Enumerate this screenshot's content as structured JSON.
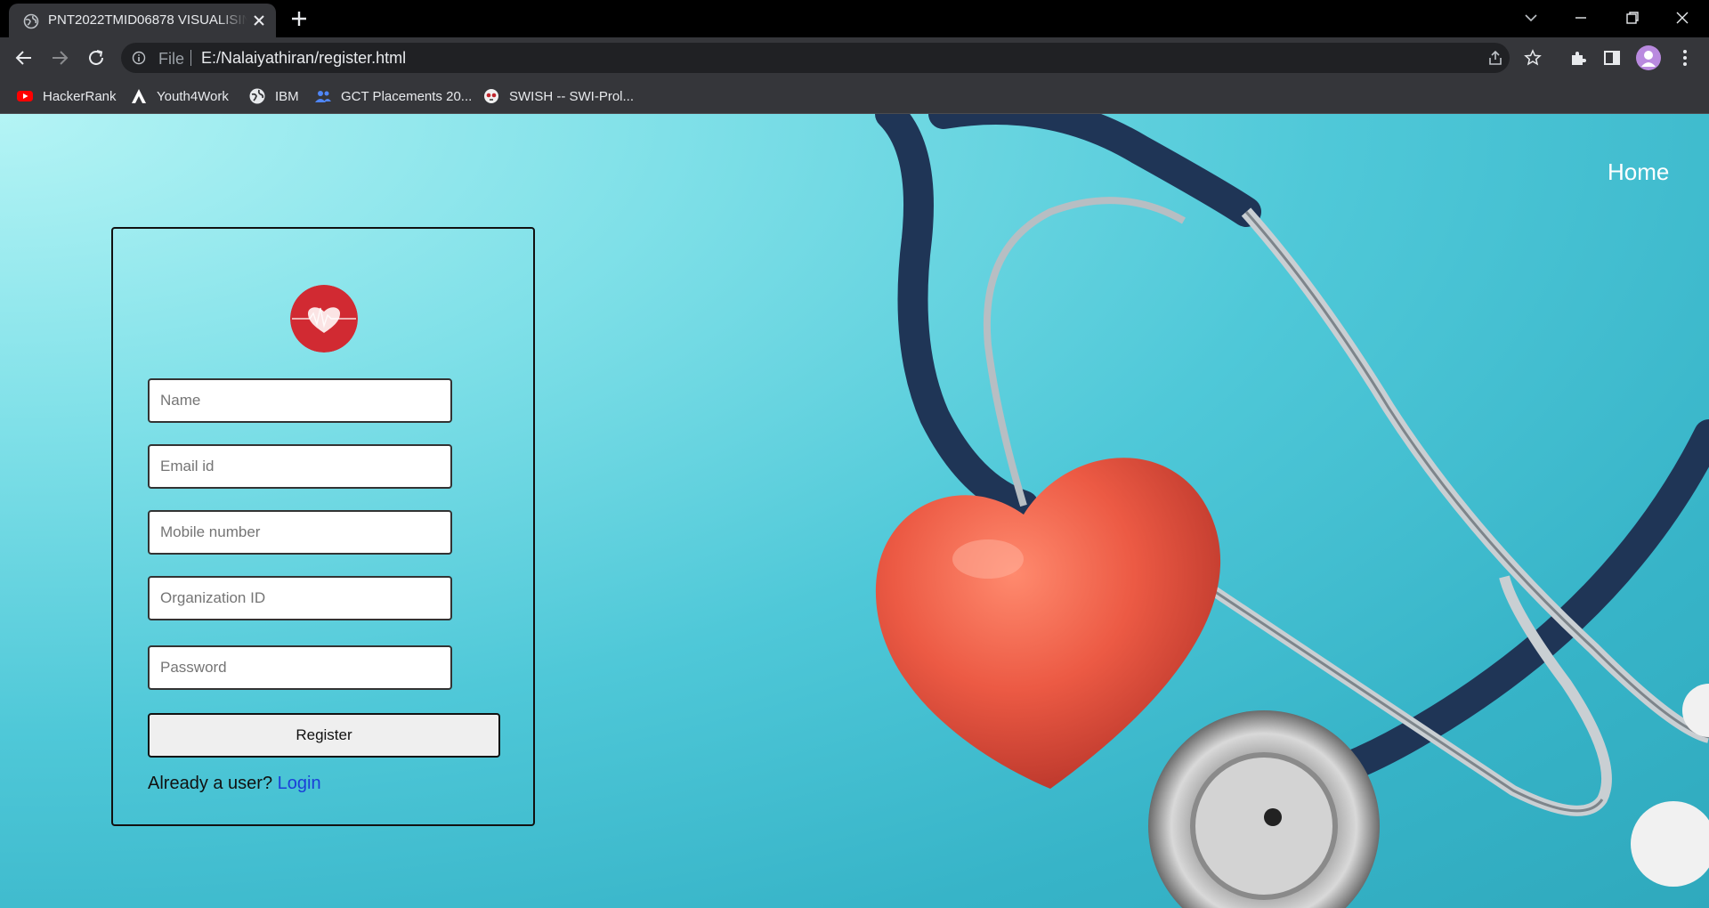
{
  "browser": {
    "tab_title": "PNT2022TMID06878 VISUALISING",
    "url_scheme": "File",
    "url": "E:/Nalaiyathiran/register.html",
    "bookmarks": [
      {
        "label": "HackerRank",
        "icon": "youtube-icon"
      },
      {
        "label": "Youth4Work",
        "icon": "a-logo-icon"
      },
      {
        "label": "IBM",
        "icon": "globe-icon"
      },
      {
        "label": "GCT Placements 20...",
        "icon": "people-icon"
      },
      {
        "label": "SWISH -- SWI-Prol...",
        "icon": "owl-icon"
      }
    ]
  },
  "nav": {
    "home_label": "Home"
  },
  "form": {
    "name_placeholder": "Name",
    "email_placeholder": "Email id",
    "mobile_placeholder": "Mobile number",
    "org_placeholder": "Organization ID",
    "password_placeholder": "Password",
    "register_label": "Register",
    "already_text": "Already a user?",
    "login_label": "Login"
  },
  "colors": {
    "chrome_dark": "#000000",
    "toolbar": "#35363a",
    "accent_link": "#1a3fd8",
    "background_teal": "#37b4c8",
    "heart_red": "#e8503d"
  }
}
